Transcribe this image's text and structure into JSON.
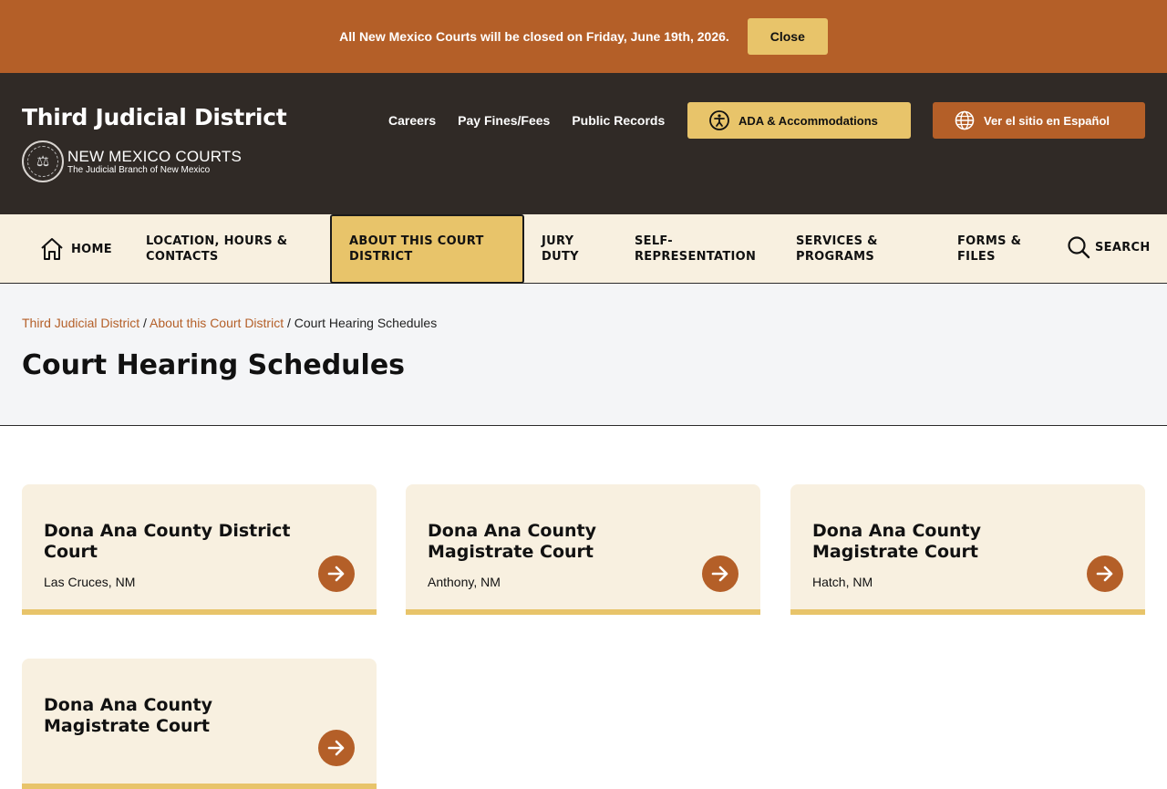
{
  "alert": {
    "message": "All New Mexico Courts will be closed on Friday, June 19th, 2026.",
    "close_label": "Close"
  },
  "header": {
    "site_title": "Third Judicial District",
    "logo_main": "NEW MEXICO COURTS",
    "logo_sub": "The Judicial Branch of New Mexico",
    "links": [
      "Careers",
      "Pay Fines/Fees",
      "Public Records"
    ],
    "ada_label": "ADA & Accommodations",
    "spanish_label": "Ver el sitio en Español"
  },
  "nav": {
    "home": "HOME",
    "location": "LOCATION, HOURS & CONTACTS",
    "about": "ABOUT THIS COURT DISTRICT",
    "jury": "JURY DUTY",
    "self_rep": "SELF-REPRESENTATION",
    "services": "SERVICES & PROGRAMS",
    "forms": "FORMS & FILES",
    "search": "SEARCH"
  },
  "breadcrumb": {
    "crumb1": "Third Judicial District",
    "crumb2": "About this Court District",
    "current": "Court Hearing Schedules",
    "separator": "/"
  },
  "page_title": "Court Hearing Schedules",
  "cards": [
    {
      "title": "Dona Ana County District Court",
      "location": "Las Cruces, NM"
    },
    {
      "title": "Dona Ana County Magistrate Court",
      "location": "Anthony, NM"
    },
    {
      "title": "Dona Ana County Magistrate Court",
      "location": "Hatch, NM"
    },
    {
      "title": "Dona Ana County Magistrate Court",
      "location": ""
    }
  ],
  "colors": {
    "accent": "#b45f28",
    "gold": "#e8c46a",
    "header_bg": "#302a26",
    "cream": "#f8f0e0"
  }
}
